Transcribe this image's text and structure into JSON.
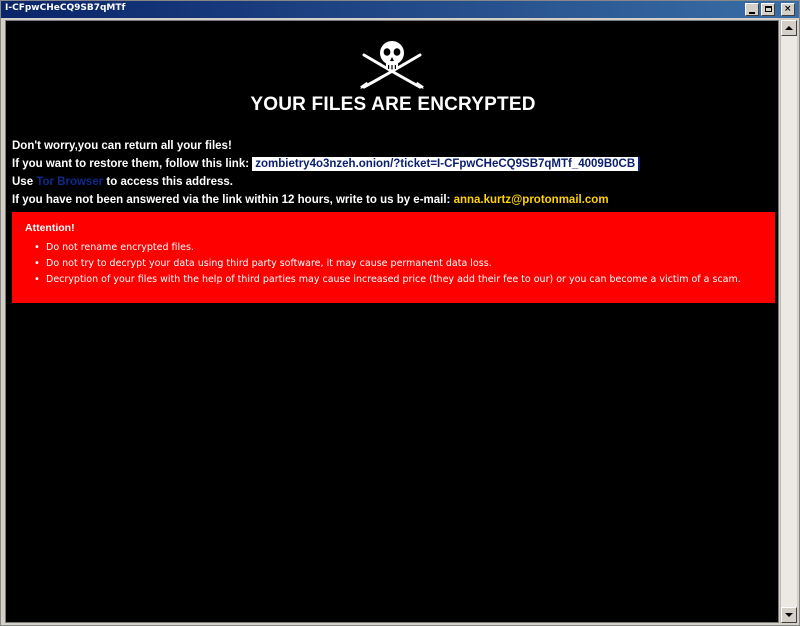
{
  "window": {
    "title": "I-CFpwCHeCQ9SB7qMTf",
    "close_glyph": "×"
  },
  "logo": {
    "icon": "jolly-roger-skull-swords-icon"
  },
  "heading": "YOUR FILES ARE ENCRYPTED",
  "message": {
    "line1": "Don't worry,you can return all your files!",
    "line2_prefix": "If you want to restore them, follow this link:",
    "link": "zombietry4o3nzeh.onion/?ticket=I-CFpwCHeCQ9SB7qMTf_4009B0CB",
    "line3_prefix": "Use",
    "tor_browser": "Tor Browser",
    "line3_suffix": "to access this address.",
    "line4_prefix": "If you have not been answered via the link within 12 hours, write to us by e-mail:",
    "email": "anna.kurtz@protonmail.com"
  },
  "attention": {
    "title": "Attention!",
    "items": [
      "Do not rename encrypted files.",
      "Do not try to decrypt your data using third party software, it may cause permanent data loss.",
      "Decryption of your files with the help of third parties may cause increased price (they add their fee to our) or you can become a victim of a scam."
    ]
  },
  "colors": {
    "background": "#000000",
    "attention_bg": "#ff0000",
    "email": "#ffd200",
    "link_bg": "#ffffff",
    "link_text": "#0a1e6e",
    "tor_link": "#0d2a8a"
  }
}
